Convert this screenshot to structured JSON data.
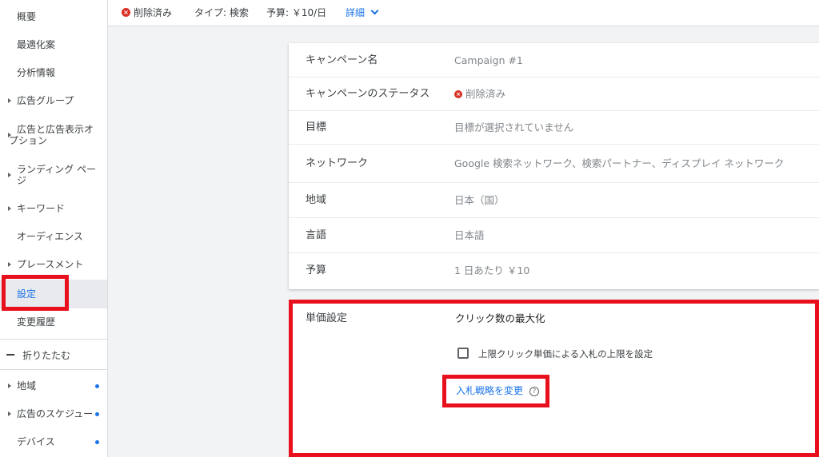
{
  "sidebar": {
    "items": [
      {
        "label": "概要",
        "expandable": false
      },
      {
        "label": "最適化案",
        "expandable": false
      },
      {
        "label": "分析情報",
        "expandable": false
      },
      {
        "label": "広告グループ",
        "expandable": true
      },
      {
        "label1": "広告と広告表示オ",
        "label2": "プション",
        "expandable": true
      },
      {
        "label1": "ランディング ペー",
        "label2": "ジ",
        "expandable": true
      },
      {
        "label": "キーワード",
        "expandable": true
      },
      {
        "label": "オーディエンス",
        "expandable": false
      },
      {
        "label": "プレースメント",
        "expandable": true
      },
      {
        "label": "設定",
        "selected": true
      },
      {
        "label": "変更履歴",
        "expandable": false
      }
    ],
    "collapse_label": "折りたたむ",
    "extra_items": [
      {
        "label": "地域",
        "dot": true
      },
      {
        "label": "広告のスケジュー",
        "dot": true
      },
      {
        "label": "デバイス",
        "dot": true
      }
    ]
  },
  "topbar": {
    "status": "削除済み",
    "type": "タイプ: 検索",
    "budget": "予算: ￥10/日",
    "details": "詳細"
  },
  "settings": {
    "rows": [
      {
        "label": "キャンペーン名",
        "value": "Campaign #1"
      },
      {
        "label": "キャンペーンのステータス",
        "value": "削除済み"
      },
      {
        "label": "目標",
        "value": "目標が選択されていません"
      },
      {
        "label": "ネットワーク",
        "value": "Google 検索ネットワーク、検索パートナー、ディスプレイ ネットワーク"
      },
      {
        "label": "地域",
        "value": "日本（国）"
      },
      {
        "label": "言語",
        "value": "日本語"
      },
      {
        "label": "予算",
        "value": "1 日あたり ￥10"
      }
    ]
  },
  "bidding": {
    "label": "単価設定",
    "value": "クリック数の最大化",
    "checkbox_label": "上限クリック単価による入札の上限を設定",
    "checkbox_checked": false,
    "change_link": "入札戦略を変更"
  },
  "colors": {
    "accent": "#1a73e8",
    "highlight": "#e8101c",
    "removed": "#d93025"
  }
}
